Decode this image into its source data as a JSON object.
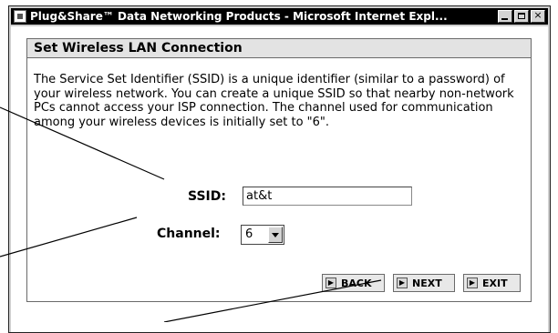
{
  "window": {
    "title": "Plug&Share™ Data Networking Products - Microsoft Internet Expl...",
    "controls": {
      "minimize": "minimize",
      "maximize": "maximize",
      "close": "×"
    }
  },
  "panel": {
    "title": "Set Wireless LAN Connection",
    "description": "The Service Set Identifier (SSID) is a unique identifier (similar to a password) of your wireless network. You can create a unique SSID so that nearby non-network PCs cannot access your ISP connection. The channel used for communication among your wireless devices is initially set to \"6\"."
  },
  "form": {
    "ssid_label": "SSID:",
    "ssid_value": "at&t",
    "channel_label": "Channel:",
    "channel_value": "6"
  },
  "buttons": {
    "back": "BACK",
    "next": "NEXT",
    "exit": "EXIT",
    "arrow_glyph": "▶"
  }
}
